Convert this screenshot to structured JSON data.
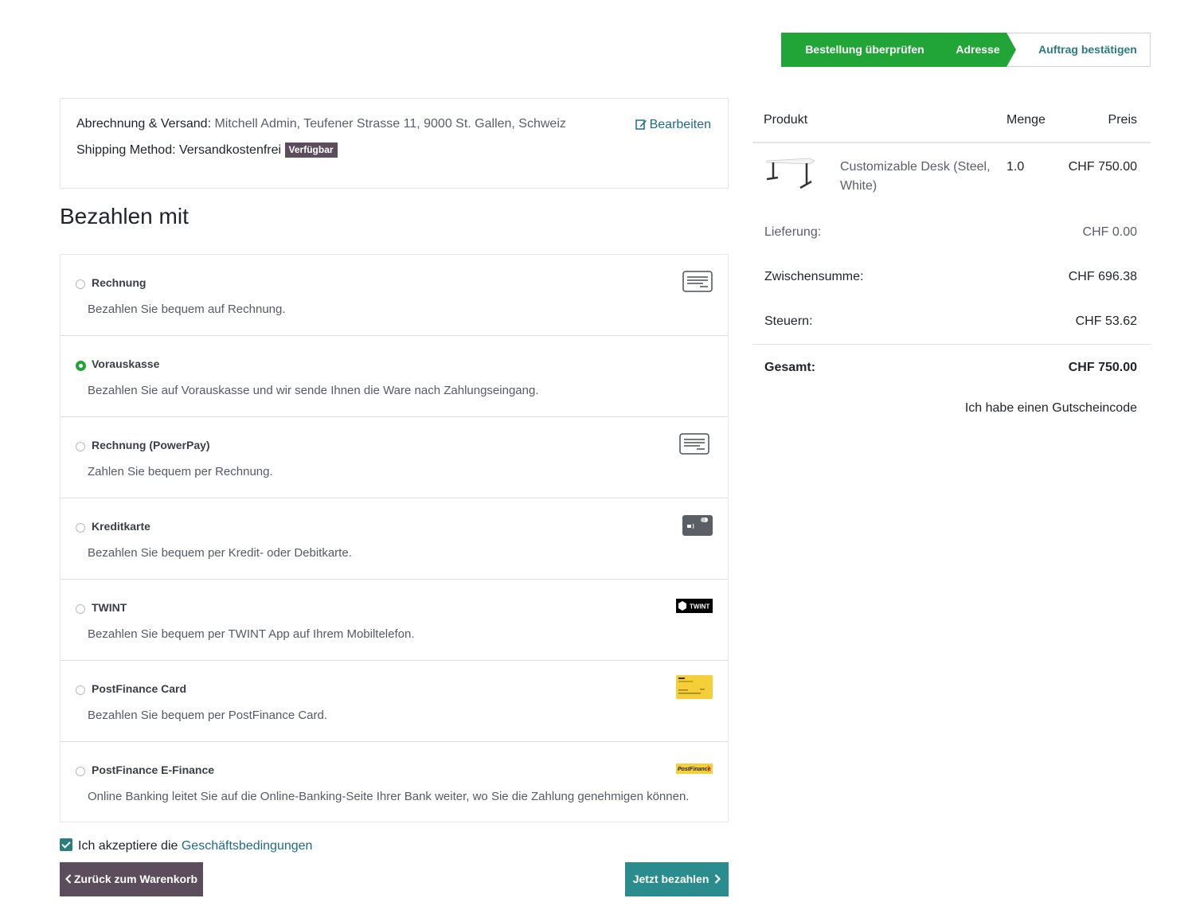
{
  "steps": [
    "Bestellung überprüfen",
    "Adresse",
    "Auftrag bestätigen"
  ],
  "address": {
    "label": "Abrechnung & Versand:",
    "value": "Mitchell Admin, Teufener Strasse 11, 9000 St. Gallen, Schweiz",
    "edit_label": "Bearbeiten",
    "shipping_label": "Shipping Method:",
    "shipping_value": "Versandkostenfrei",
    "shipping_badge": "Verfügbar"
  },
  "payment": {
    "title": "Bezahlen mit",
    "methods": [
      {
        "name": "Rechnung",
        "description": "Bezahlen Sie bequem auf Rechnung.",
        "selected": false,
        "icon": "invoice-icon"
      },
      {
        "name": "Vorauskasse",
        "description": "Bezahlen Sie auf Vorauskasse und wir sende Ihnen die Ware nach Zahlungseingang.",
        "selected": true,
        "icon": ""
      },
      {
        "name": "Rechnung (PowerPay)",
        "description": "Zahlen Sie bequem per Rechnung.",
        "selected": false,
        "icon": "invoice-icon"
      },
      {
        "name": "Kreditkarte",
        "description": "Bezahlen Sie bequem per Kredit- oder Debitkarte.",
        "selected": false,
        "icon": "credit-card-icon"
      },
      {
        "name": "TWINT",
        "description": "Bezahlen Sie bequem per TWINT App auf Ihrem Mobiltelefon.",
        "selected": false,
        "icon": "twint-logo"
      },
      {
        "name": "PostFinance Card",
        "description": "Bezahlen Sie bequem per PostFinance Card.",
        "selected": false,
        "icon": "postfinance-card-icon"
      },
      {
        "name": "PostFinance E-Finance",
        "description": "Online Banking leitet Sie auf die Online-Banking-Seite Ihrer Bank weiter, wo Sie die Zahlung genehmigen können.",
        "selected": false,
        "icon": "postfinance-logo"
      }
    ],
    "twint_logo_text": "TWINT",
    "postfinance_logo_text": "PostFinance"
  },
  "terms": {
    "prefix": "Ich akzeptiere die",
    "link": "Geschäftsbedingungen",
    "checked": true
  },
  "buttons": {
    "back": "Zurück zum Warenkorb",
    "pay": "Jetzt bezahlen"
  },
  "cart": {
    "headers": {
      "product": "Produkt",
      "qty": "Menge",
      "price": "Preis"
    },
    "items": [
      {
        "name": "Customizable Desk (Steel, White)",
        "qty": "1.0",
        "price": "CHF 750.00"
      }
    ],
    "delivery": {
      "label": "Lieferung:",
      "value": "CHF 0.00"
    },
    "subtotal": {
      "label": "Zwischensumme:",
      "value": "CHF 696.38"
    },
    "taxes": {
      "label": "Steuern:",
      "value": "CHF 53.62"
    },
    "total": {
      "label": "Gesamt:",
      "value": "CHF 750.00"
    },
    "coupon": "Ich habe einen Gutscheincode"
  },
  "colors": {
    "primary_green": "#21a536",
    "teal": "#2a8c8c",
    "dark_button": "#5c4d5c",
    "link": "#1d6b8a"
  }
}
